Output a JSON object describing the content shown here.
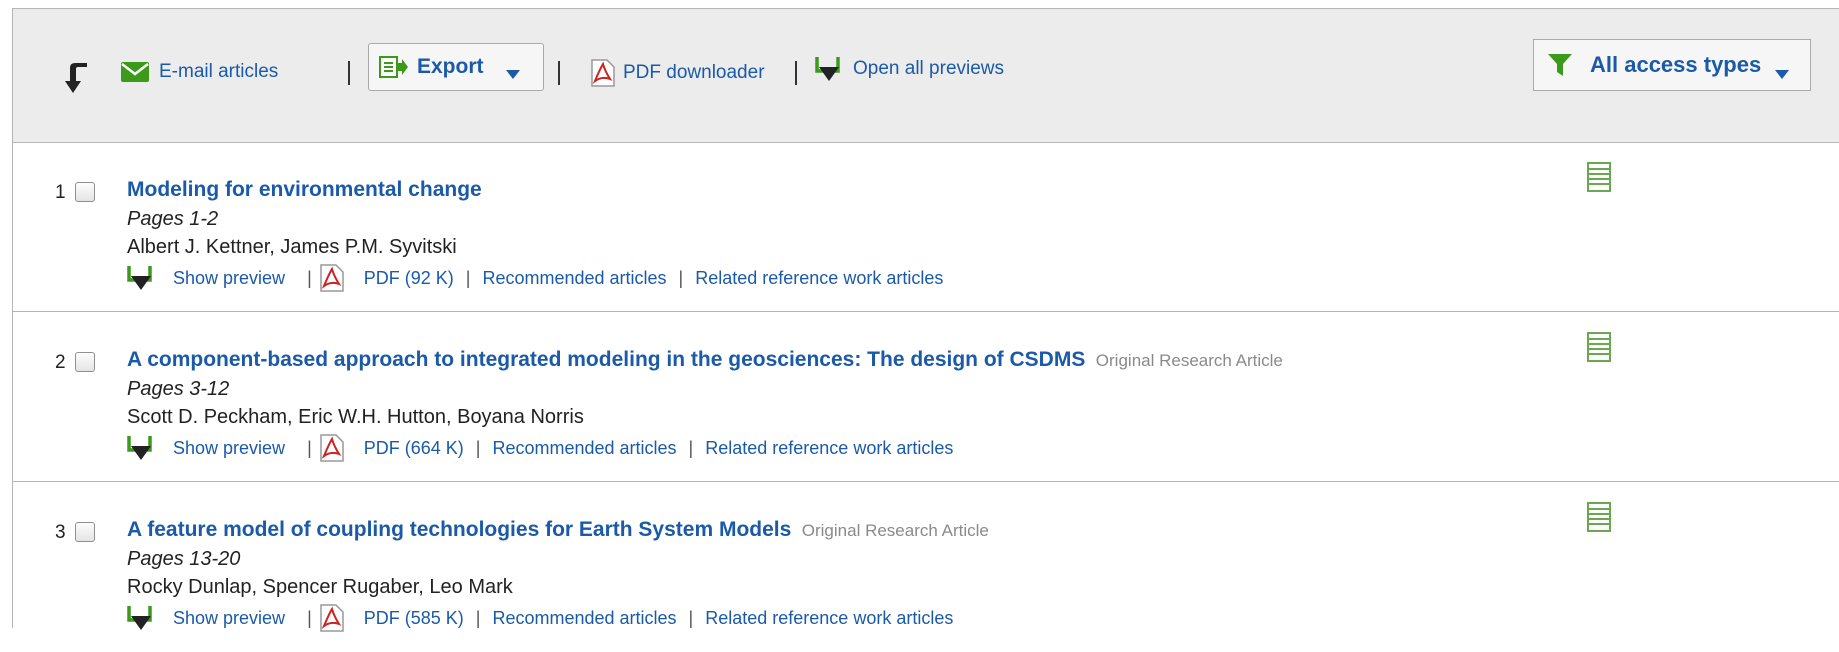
{
  "toolbar": {
    "email_label": "E-mail articles",
    "export_label": "Export",
    "pdf_downloader_label": "PDF downloader",
    "open_previews_label": "Open all previews",
    "access_label": "All access types",
    "separator": "|"
  },
  "articles": [
    {
      "number": "1",
      "title": "Modeling for environmental change",
      "type": "",
      "pages": "Pages 1-2",
      "authors": "Albert J. Kettner, James P.M. Syvitski",
      "show_preview": "Show preview",
      "pdf": "PDF (92 K)",
      "recommended": "Recommended articles",
      "related": "Related reference work articles"
    },
    {
      "number": "2",
      "title": "A component-based approach to integrated modeling in the geosciences: The design of CSDMS",
      "type": "Original Research Article",
      "pages": "Pages 3-12",
      "authors": "Scott D. Peckham, Eric W.H. Hutton, Boyana Norris",
      "show_preview": "Show preview",
      "pdf": "PDF (664 K)",
      "recommended": "Recommended articles",
      "related": "Related reference work articles"
    },
    {
      "number": "3",
      "title": "A feature model of coupling technologies for Earth System Models",
      "type": "Original Research Article",
      "pages": "Pages 13-20",
      "authors": "Rocky Dunlap, Spencer Rugaber, Leo Mark",
      "show_preview": "Show preview",
      "pdf": "PDF (585 K)",
      "recommended": "Recommended articles",
      "related": "Related reference work articles"
    }
  ],
  "colors": {
    "link": "#1b5aa8",
    "toolbar_bg": "#ececec",
    "preview_green": "#3c9a1a",
    "abstract_green": "#6aa84f",
    "pdf_red": "#cc2222"
  },
  "icons": {
    "select_all": "curved-arrow-down-icon",
    "email": "envelope-icon",
    "export": "export-icon",
    "pdf": "pdf-icon",
    "preview": "preview-arrow-icon",
    "filter": "filter-funnel-icon",
    "abstract": "abstract-list-icon"
  }
}
